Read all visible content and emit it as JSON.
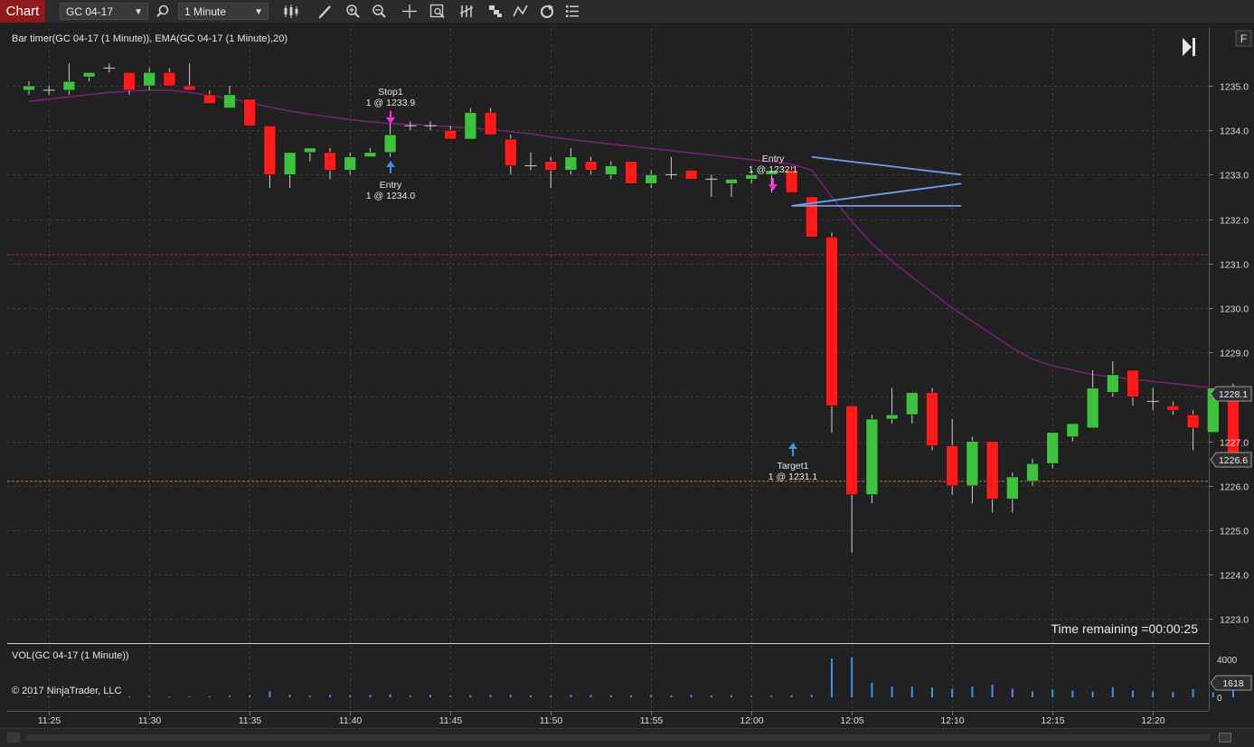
{
  "toolbar": {
    "tab_label": "Chart",
    "instrument": "GC 04-17",
    "interval": "1 Minute"
  },
  "chart": {
    "indicators_label": "Bar timer(GC 04-17 (1 Minute)), EMA(GC 04-17 (1 Minute),20)",
    "f_button": "F",
    "time_remaining": "Time remaining =00:00:25",
    "volume_label": "VOL(GC 04-17 (1 Minute))",
    "copyright": "© 2017 NinjaTrader, LLC",
    "last_price_marker": "1228.1",
    "position_price_marker": "1226.6",
    "volume_marker": "1618",
    "volume_axis_labels": [
      "4000",
      "0"
    ],
    "colors": {
      "up": "#3cc23c",
      "down": "#ff1a1a",
      "ema": "#7b1f7b",
      "trend": "#6f9cf0",
      "volume": "#3f8ff5"
    }
  },
  "orders": [
    {
      "name": "stop1",
      "title": "Stop1",
      "detail": "1 @ 1233.9"
    },
    {
      "name": "entry1",
      "title": "Entry",
      "detail": "1 @ 1234.0"
    },
    {
      "name": "entry2",
      "title": "Entry",
      "detail": "1 @ 1232.1"
    },
    {
      "name": "target1",
      "title": "Target1",
      "detail": "1 @ 1231.1"
    }
  ],
  "chart_data": {
    "type": "candlestick",
    "start_time": "11:24",
    "interval_minutes": 1,
    "y_ticks": [
      1223,
      1224,
      1225,
      1226,
      1227,
      1228,
      1229,
      1230,
      1231,
      1232,
      1233,
      1234,
      1235
    ],
    "y_tick_labels": [
      "1223.0",
      "1224.0",
      "1225.0",
      "1226.0",
      "1227.0",
      "1228.0",
      "1229.0",
      "1230.0",
      "1231.0",
      "1232.0",
      "1233.0",
      "1234.0",
      "1235.0"
    ],
    "x_tick_labels": [
      "11:25",
      "11:30",
      "11:35",
      "11:40",
      "11:45",
      "11:50",
      "11:55",
      "12:00",
      "12:05",
      "12:10",
      "12:15",
      "12:20"
    ],
    "ohlc": [
      [
        1234.9,
        1235.1,
        1234.8,
        1235.0
      ],
      [
        1234.9,
        1235.0,
        1234.8,
        1234.9
      ],
      [
        1234.9,
        1235.5,
        1234.8,
        1235.1
      ],
      [
        1235.2,
        1235.3,
        1235.1,
        1235.3
      ],
      [
        1235.4,
        1235.5,
        1235.3,
        1235.4
      ],
      [
        1235.3,
        1235.3,
        1234.8,
        1234.9
      ],
      [
        1235.0,
        1235.4,
        1234.9,
        1235.3
      ],
      [
        1235.3,
        1235.4,
        1235.0,
        1235.0
      ],
      [
        1235.0,
        1235.5,
        1234.9,
        1234.9
      ],
      [
        1234.8,
        1234.9,
        1234.6,
        1234.6
      ],
      [
        1234.5,
        1235.0,
        1234.5,
        1234.8
      ],
      [
        1234.7,
        1234.7,
        1234.1,
        1234.1
      ],
      [
        1234.1,
        1234.1,
        1232.7,
        1233.0
      ],
      [
        1233.0,
        1233.5,
        1232.7,
        1233.5
      ],
      [
        1233.5,
        1233.6,
        1233.3,
        1233.6
      ],
      [
        1233.5,
        1233.6,
        1232.9,
        1233.1
      ],
      [
        1233.1,
        1233.5,
        1233.0,
        1233.4
      ],
      [
        1233.4,
        1233.6,
        1233.4,
        1233.5
      ],
      [
        1233.5,
        1234.2,
        1233.4,
        1233.9
      ],
      [
        1234.1,
        1234.2,
        1234.0,
        1234.1
      ],
      [
        1234.1,
        1234.2,
        1234.0,
        1234.1
      ],
      [
        1234.0,
        1234.1,
        1233.8,
        1233.8
      ],
      [
        1233.8,
        1234.5,
        1233.8,
        1234.4
      ],
      [
        1234.4,
        1234.5,
        1233.9,
        1233.9
      ],
      [
        1233.8,
        1233.9,
        1233.0,
        1233.2
      ],
      [
        1233.2,
        1233.5,
        1233.1,
        1233.2
      ],
      [
        1233.3,
        1233.4,
        1232.7,
        1233.1
      ],
      [
        1233.1,
        1233.6,
        1233.0,
        1233.4
      ],
      [
        1233.3,
        1233.4,
        1233.0,
        1233.1
      ],
      [
        1233.0,
        1233.3,
        1232.9,
        1233.2
      ],
      [
        1233.3,
        1233.3,
        1232.8,
        1232.8
      ],
      [
        1232.8,
        1233.1,
        1232.7,
        1233.0
      ],
      [
        1233.0,
        1233.4,
        1232.9,
        1233.0
      ],
      [
        1233.1,
        1233.1,
        1232.9,
        1232.9
      ],
      [
        1232.9,
        1233.0,
        1232.5,
        1232.9
      ],
      [
        1232.8,
        1232.9,
        1232.5,
        1232.9
      ],
      [
        1232.9,
        1233.1,
        1232.8,
        1233.0
      ],
      [
        1233.0,
        1233.1,
        1232.6,
        1233.1
      ],
      [
        1233.1,
        1233.2,
        1232.6,
        1232.6
      ],
      [
        1232.5,
        1232.5,
        1231.6,
        1231.6
      ],
      [
        1231.6,
        1231.7,
        1227.2,
        1227.8
      ],
      [
        1227.8,
        1227.8,
        1224.5,
        1225.8
      ],
      [
        1225.8,
        1227.6,
        1225.6,
        1227.5
      ],
      [
        1227.5,
        1228.2,
        1227.4,
        1227.6
      ],
      [
        1227.6,
        1228.1,
        1227.4,
        1228.1
      ],
      [
        1228.1,
        1228.2,
        1226.8,
        1226.9
      ],
      [
        1226.9,
        1227.5,
        1225.8,
        1226.0
      ],
      [
        1226.0,
        1227.1,
        1225.6,
        1227.0
      ],
      [
        1227.0,
        1227.0,
        1225.4,
        1225.7
      ],
      [
        1225.7,
        1226.3,
        1225.4,
        1226.2
      ],
      [
        1226.1,
        1226.6,
        1226.0,
        1226.5
      ],
      [
        1226.5,
        1227.2,
        1226.4,
        1227.2
      ],
      [
        1227.1,
        1227.4,
        1227.0,
        1227.4
      ],
      [
        1227.3,
        1228.6,
        1227.3,
        1228.2
      ],
      [
        1228.1,
        1228.8,
        1228.0,
        1228.5
      ],
      [
        1228.6,
        1228.6,
        1227.8,
        1228.0
      ],
      [
        1227.9,
        1228.2,
        1227.7,
        1227.9
      ],
      [
        1227.8,
        1227.9,
        1227.6,
        1227.7
      ],
      [
        1227.6,
        1227.7,
        1226.8,
        1227.3
      ],
      [
        1227.2,
        1228.2,
        1227.2,
        1228.2
      ],
      [
        1228.1,
        1228.3,
        1226.6,
        1226.6
      ]
    ],
    "ema": [
      1234.65,
      1234.7,
      1234.75,
      1234.8,
      1234.85,
      1234.88,
      1234.9,
      1234.9,
      1234.85,
      1234.78,
      1234.72,
      1234.62,
      1234.52,
      1234.43,
      1234.36,
      1234.3,
      1234.24,
      1234.19,
      1234.15,
      1234.13,
      1234.11,
      1234.08,
      1234.05,
      1234.02,
      1233.97,
      1233.92,
      1233.85,
      1233.79,
      1233.74,
      1233.69,
      1233.64,
      1233.59,
      1233.54,
      1233.49,
      1233.44,
      1233.39,
      1233.34,
      1233.29,
      1233.24,
      1233.1,
      1232.5,
      1231.95,
      1231.45,
      1231.05,
      1230.7,
      1230.35,
      1230.0,
      1229.7,
      1229.4,
      1229.1,
      1228.85,
      1228.7,
      1228.6,
      1228.5,
      1228.45,
      1228.4,
      1228.35,
      1228.3,
      1228.25,
      1228.2,
      1228.18
    ],
    "volume": [
      50,
      60,
      60,
      80,
      70,
      90,
      80,
      70,
      90,
      100,
      150,
      200,
      600,
      250,
      150,
      250,
      200,
      250,
      300,
      150,
      250,
      150,
      200,
      250,
      250,
      200,
      200,
      250,
      250,
      200,
      200,
      250,
      200,
      250,
      200,
      200,
      150,
      150,
      200,
      250,
      4000,
      4100,
      1500,
      1100,
      1100,
      1000,
      900,
      1100,
      1300,
      900,
      600,
      800,
      700,
      600,
      1050,
      700,
      600,
      550,
      850,
      500,
      1300
    ],
    "reference_lines": [
      1231.2,
      1226.1
    ],
    "trendlines": [
      {
        "from": [
          38,
          1232.3
        ],
        "to": [
          46,
          1232.3
        ]
      },
      {
        "from": [
          38,
          1232.3
        ],
        "to": [
          46,
          1232.8
        ]
      },
      {
        "from": [
          39,
          1233.4
        ],
        "to": [
          46,
          1233.0
        ]
      }
    ]
  }
}
